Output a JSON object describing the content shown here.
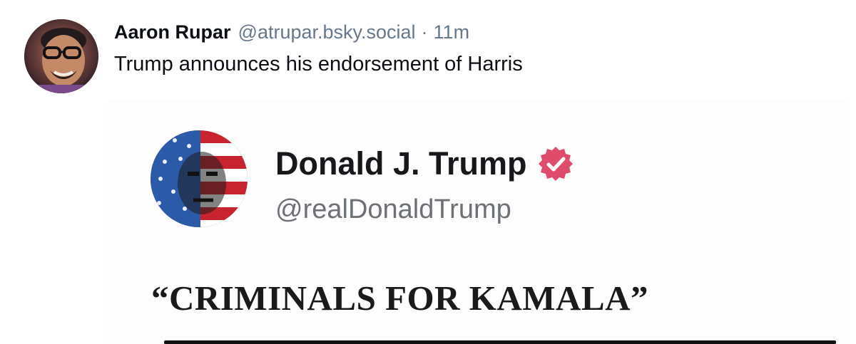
{
  "post": {
    "author_name": "Aaron Rupar",
    "author_handle": "@atrupar.bsky.social",
    "separator": "·",
    "timestamp": "11m",
    "text": "Trump announces his endorsement of Harris"
  },
  "embed": {
    "display_name": "Donald J. Trump",
    "handle": "@realDonaldTrump",
    "verified": true,
    "headline": "“CRIMINALS FOR KAMALA”"
  },
  "colors": {
    "name": "#0b0f14",
    "muted": "#66778a",
    "verified_badge": "#e04a6b"
  },
  "icons": {
    "author_avatar": "avatar-photo",
    "embed_avatar": "flag-portrait-avatar",
    "verified": "verified-badge-icon"
  }
}
